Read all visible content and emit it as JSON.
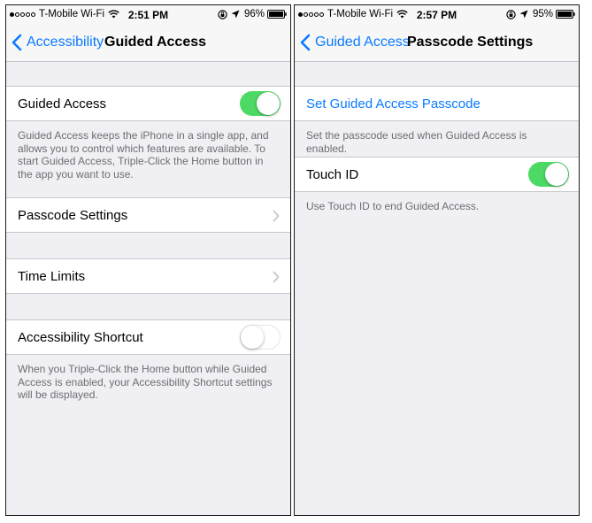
{
  "colors": {
    "accent": "#0a7aff",
    "toggle_on": "#4cd964",
    "group_background": "#efeff4",
    "footer_text": "#6d6d72"
  },
  "left": {
    "status": {
      "carrier": "T-Mobile Wi-Fi",
      "time": "2:51 PM",
      "battery": "96%"
    },
    "nav": {
      "back_label": "Accessibility",
      "title": "Guided Access"
    },
    "guided_access": {
      "label": "Guided Access",
      "enabled": true
    },
    "guided_access_footer": "Guided Access keeps the iPhone in a single app, and allows you to control which features are available. To start Guided Access, Triple-Click the Home button in the app you want to use.",
    "passcode_settings": {
      "label": "Passcode Settings"
    },
    "time_limits": {
      "label": "Time Limits"
    },
    "accessibility_shortcut": {
      "label": "Accessibility Shortcut",
      "enabled": false
    },
    "shortcut_footer": "When you Triple-Click the Home button while Guided Access is enabled, your Accessibility Shortcut settings will be displayed."
  },
  "right": {
    "status": {
      "carrier": "T-Mobile Wi-Fi",
      "time": "2:57 PM",
      "battery": "95%"
    },
    "nav": {
      "back_label": "Guided Access",
      "title": "Passcode Settings"
    },
    "set_passcode": {
      "label": "Set Guided Access Passcode"
    },
    "set_passcode_footer": "Set the passcode used when Guided Access is enabled.",
    "touch_id": {
      "label": "Touch ID",
      "enabled": true
    },
    "touch_id_footer": "Use Touch ID to end Guided Access."
  }
}
